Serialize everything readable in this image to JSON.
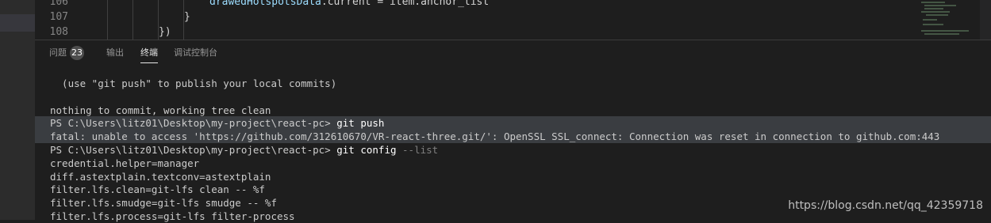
{
  "editor": {
    "lines": [
      {
        "num": "106",
        "text": "drawedHotspotsData.current = item.anchor_list"
      },
      {
        "num": "107",
        "text": "}"
      },
      {
        "num": "108",
        "text": "})"
      }
    ]
  },
  "panel": {
    "tabs": [
      {
        "label": "问题",
        "badge": "23"
      },
      {
        "label": "输出"
      },
      {
        "label": "终端"
      },
      {
        "label": "调试控制台"
      }
    ],
    "active_tab": "终端"
  },
  "terminal": {
    "lines": [
      {
        "text": "  (use \"git push\" to publish your local commits)"
      },
      {
        "text": ""
      },
      {
        "text": "nothing to commit, working tree clean"
      },
      {
        "prompt": "PS C:\\Users\\litz01\\Desktop\\my-project\\react-pc> ",
        "cmd": "git push",
        "highlight": true
      },
      {
        "text": "fatal: unable to access 'https://github.com/312610670/VR-react-three.git/': OpenSSL SSL_connect: Connection was reset in connection to github.com:443",
        "highlight": true
      },
      {
        "prompt": "PS C:\\Users\\litz01\\Desktop\\my-project\\react-pc> ",
        "cmd": "git config",
        "arg": " --list"
      },
      {
        "text": "credential.helper=manager"
      },
      {
        "text": "diff.astextplain.textconv=astextplain"
      },
      {
        "text": "filter.lfs.clean=git-lfs clean -- %f"
      },
      {
        "text": "filter.lfs.smudge=git-lfs smudge -- %f"
      },
      {
        "text": "filter.lfs.process=git-lfs filter-process"
      }
    ]
  },
  "watermark": "https://blog.csdn.net/qq_42359718",
  "colors": {
    "background": "#1e1e1e",
    "highlight": "#3a3d41",
    "code_variable": "#9cdcfe",
    "code_text": "#d4d4d4"
  }
}
